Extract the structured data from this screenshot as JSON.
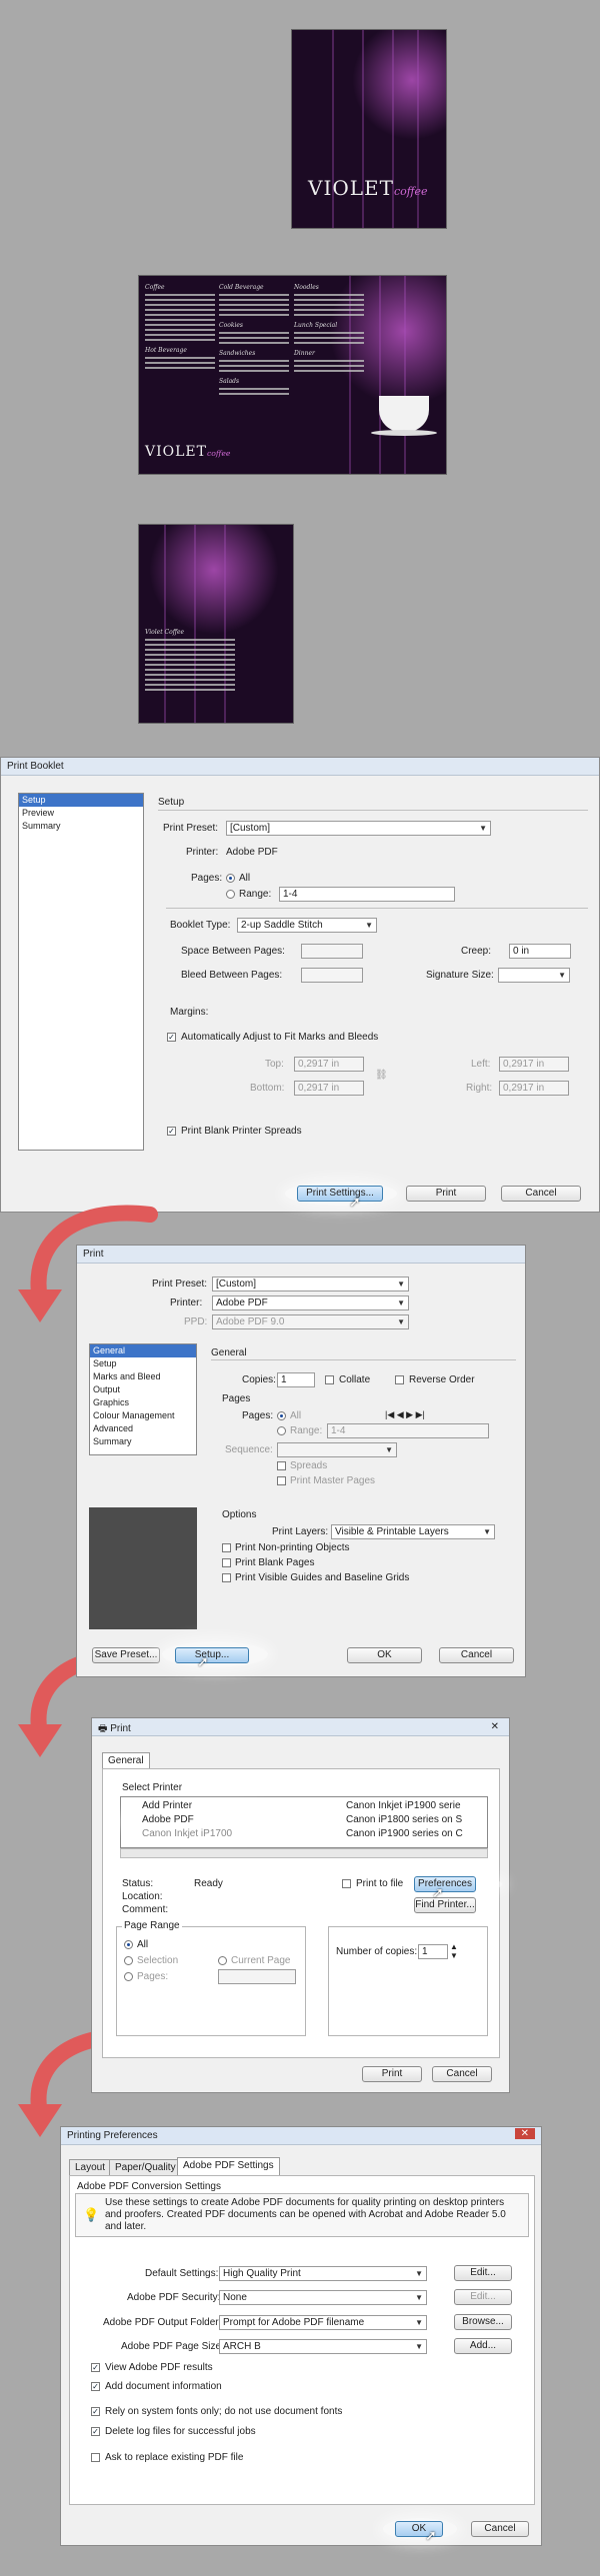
{
  "previews": {
    "cover": {
      "logo_main": "VIOLET",
      "logo_sub": "coffee"
    },
    "spread": {
      "logo_main": "VIOLET",
      "logo_sub": "coffee"
    },
    "back": {
      "heading": "Violet Coffee"
    }
  },
  "booklet": {
    "title": "Print Booklet",
    "nav": [
      "Setup",
      "Preview",
      "Summary"
    ],
    "section_title": "Setup",
    "preset_label": "Print Preset:",
    "preset_value": "[Custom]",
    "printer_label": "Printer:",
    "printer_value": "Adobe PDF",
    "pages_label": "Pages:",
    "all_label": "All",
    "range_label": "Range:",
    "range_value": "1-4",
    "booklet_type_label": "Booklet Type:",
    "booklet_type_value": "2-up Saddle Stitch",
    "space_label": "Space Between Pages:",
    "creep_label": "Creep:",
    "creep_value": "0 in",
    "bleed_label": "Bleed Between Pages:",
    "sig_label": "Signature Size:",
    "margins_label": "Margins:",
    "auto_adjust_label": "Automatically Adjust to Fit Marks and Bleeds",
    "top_label": "Top:",
    "top_value": "0,2917 in",
    "bottom_label": "Bottom:",
    "bottom_value": "0,2917 in",
    "left_label": "Left:",
    "left_value": "0,2917 in",
    "right_label": "Right:",
    "right_value": "0,2917 in",
    "blank_spreads_label": "Print Blank Printer Spreads",
    "print_settings_button": "Print Settings...",
    "print_button": "Print",
    "cancel_button": "Cancel"
  },
  "print": {
    "title": "Print",
    "preset_label": "Print Preset:",
    "preset_value": "[Custom]",
    "printer_label": "Printer:",
    "printer_value": "Adobe PDF",
    "ppd_label": "PPD:",
    "ppd_value": "Adobe PDF 9.0",
    "nav": [
      "General",
      "Setup",
      "Marks and Bleed",
      "Output",
      "Graphics",
      "Colour Management",
      "Advanced",
      "Summary"
    ],
    "section_title": "General",
    "copies_label": "Copies:",
    "copies_value": "1",
    "collate_label": "Collate",
    "reverse_label": "Reverse Order",
    "pages_group": "Pages",
    "pages_label": "Pages:",
    "all_label": "All",
    "range_label": "Range:",
    "range_value": "1-4",
    "sequence_label": "Sequence:",
    "spreads_label": "Spreads",
    "master_label": "Print Master Pages",
    "options_group": "Options",
    "layers_label": "Print Layers:",
    "layers_value": "Visible & Printable Layers",
    "nonprinting_label": "Print Non-printing Objects",
    "blank_label": "Print Blank Pages",
    "guides_label": "Print Visible Guides and Baseline Grids",
    "save_preset_button": "Save Preset...",
    "setup_button": "Setup...",
    "ok_button": "OK",
    "cancel_button": "Cancel"
  },
  "winprint": {
    "title": "Print",
    "tab": "General",
    "select_printer": "Select Printer",
    "printers_left": [
      "Add Printer",
      "Adobe PDF",
      "Canon Inkjet iP1700"
    ],
    "printers_right": [
      "Canon Inkjet iP1900 serie",
      "Canon iP1800 series on S",
      "Canon iP1900 series on C"
    ],
    "status_label": "Status:",
    "status_value": "Ready",
    "location_label": "Location:",
    "comment_label": "Comment:",
    "print_to_file": "Print to file",
    "preferences_button": "Preferences",
    "find_printer_button": "Find Printer...",
    "page_range": "Page Range",
    "all_label": "All",
    "selection_label": "Selection",
    "current_label": "Current Page",
    "pages_label": "Pages:",
    "copies_label": "Number of copies:",
    "copies_value": "1",
    "print_button": "Print",
    "cancel_button": "Cancel"
  },
  "prefs": {
    "title": "Printing Preferences",
    "tabs": [
      "Layout",
      "Paper/Quality",
      "Adobe PDF Settings"
    ],
    "group": "Adobe PDF Conversion Settings",
    "info": "Use these settings to create Adobe PDF documents for quality printing on desktop printers and proofers. Created PDF documents can be opened with Acrobat and Adobe Reader 5.0 and later.",
    "default_label": "Default Settings:",
    "default_value": "High Quality Print",
    "edit_button": "Edit...",
    "security_label": "Adobe PDF Security:",
    "security_value": "None",
    "edit2_button": "Edit...",
    "folder_label": "Adobe PDF Output Folder",
    "folder_value": "Prompt for Adobe PDF filename",
    "browse_button": "Browse...",
    "size_label": "Adobe PDF Page Size:",
    "size_value": "ARCH B",
    "add_button": "Add...",
    "checks": [
      {
        "label": "View Adobe PDF results",
        "on": true
      },
      {
        "label": "Add document information",
        "on": true
      },
      {
        "label": "Rely on system fonts only; do not use document fonts",
        "on": true
      },
      {
        "label": "Delete log files for successful jobs",
        "on": true
      },
      {
        "label": "Ask to replace existing PDF file",
        "on": false
      }
    ],
    "ok_button": "OK",
    "cancel_button": "Cancel"
  },
  "colors": {
    "accent": "#3d74c8",
    "arrow": "#e05a5a",
    "page_bg": "#1c0a24"
  }
}
